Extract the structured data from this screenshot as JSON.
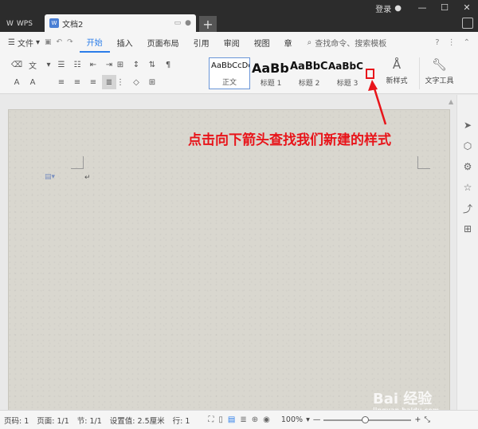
{
  "titlebar": {
    "app_name": "WPS",
    "doc_tab": "文档2",
    "new_tab": "+",
    "login": "登录",
    "window_buttons": [
      "—",
      "☐",
      "✕"
    ]
  },
  "menubar": {
    "file": "文件",
    "items": [
      "开始",
      "插入",
      "页面布局",
      "引用",
      "审阅",
      "视图",
      "章"
    ],
    "active_index": 0,
    "search_placeholder": "查找命令、搜索模板",
    "help": "?"
  },
  "ribbon": {
    "styles": [
      {
        "preview": "AaBbCcDd",
        "label": "正文"
      },
      {
        "preview": "AaBb",
        "label": "标题 1"
      },
      {
        "preview": "AaBbC",
        "label": "标题 2"
      },
      {
        "preview": "AaBbC",
        "label": "标题 3"
      }
    ],
    "new_style": "新样式",
    "text_tools": "文字工具"
  },
  "annotation": "点击向下箭头查找我们新建的样式",
  "watermark": {
    "text": "Bai 经验",
    "sub": "jingyan.baidu.com"
  },
  "statusbar": {
    "page_code": "页码: 1",
    "page": "页面: 1/1",
    "section": "节: 1/1",
    "setting": "设置值: 2.5厘米",
    "line": "行: 1",
    "zoom": "100%",
    "zoom_minus": "—",
    "zoom_plus": "+",
    "zoom_fraction": 0.47
  },
  "colors": {
    "accent": "#2b7de9",
    "annotation": "#e8141a"
  }
}
